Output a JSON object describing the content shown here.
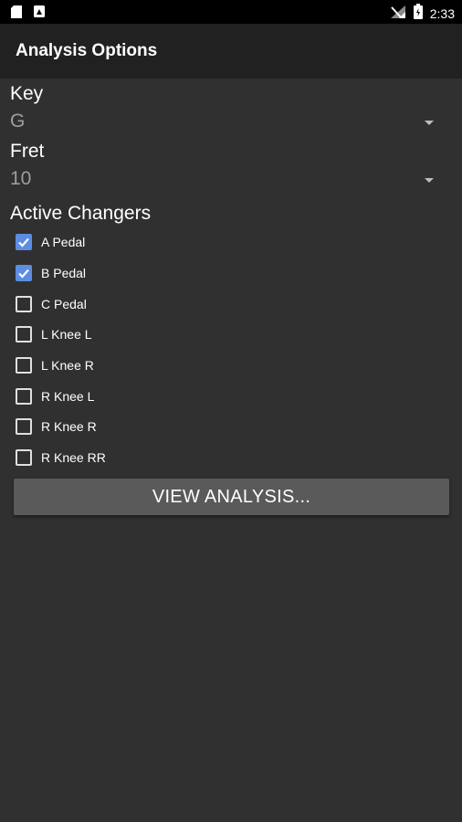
{
  "status_bar": {
    "time": "2:33",
    "icons": [
      "sd-card-icon",
      "notification-icon",
      "signal-icon",
      "battery-icon"
    ]
  },
  "app_bar": {
    "title": "Analysis Options"
  },
  "key": {
    "label": "Key",
    "value": "G"
  },
  "fret": {
    "label": "Fret",
    "value": "10"
  },
  "changers": {
    "label": "Active Changers",
    "items": [
      {
        "label": "A Pedal",
        "checked": true
      },
      {
        "label": "B Pedal",
        "checked": true
      },
      {
        "label": "C Pedal",
        "checked": false
      },
      {
        "label": "L Knee L",
        "checked": false
      },
      {
        "label": "L Knee R",
        "checked": false
      },
      {
        "label": "R Knee L",
        "checked": false
      },
      {
        "label": "R Knee R",
        "checked": false
      },
      {
        "label": "R Knee RR",
        "checked": false
      }
    ]
  },
  "view_button": {
    "label": "VIEW ANALYSIS..."
  },
  "colors": {
    "background": "#303030",
    "app_bar": "#212121",
    "checkbox_checked": "#5c8de2",
    "button": "#5a5a5a"
  }
}
